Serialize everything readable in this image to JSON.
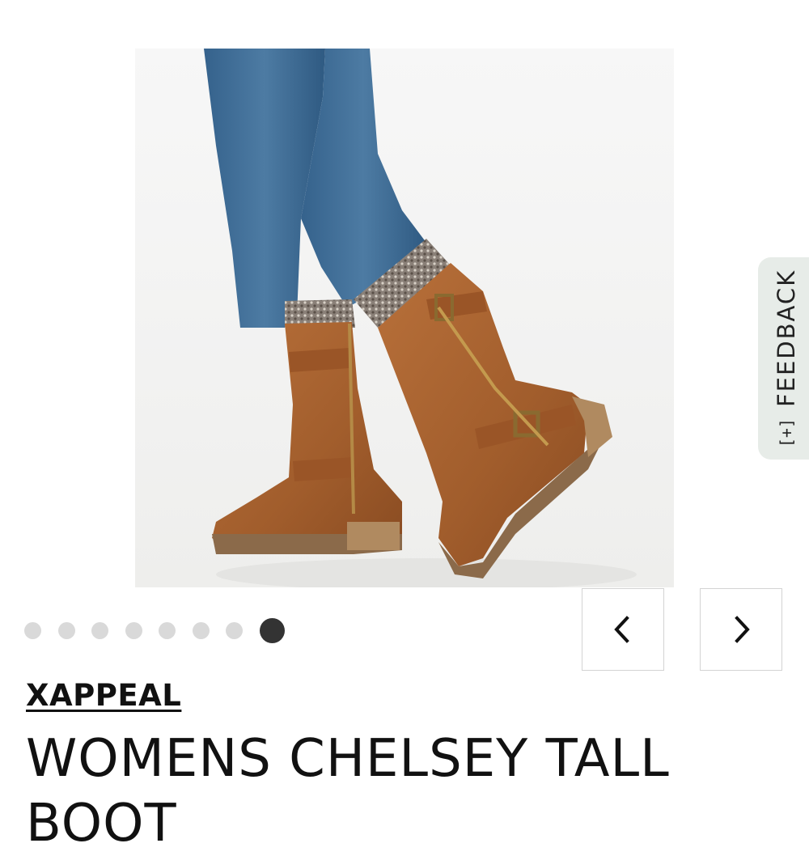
{
  "product": {
    "brand": "XAPPEAL",
    "title": "WOMENS CHELSEY TALL BOOT",
    "image_alt": "Woman wearing cognac tall boots with sweater cuffs and buckles"
  },
  "carousel": {
    "total_slides": 8,
    "active_index": 7,
    "prev_icon": "chevron-left-icon",
    "next_icon": "chevron-right-icon"
  },
  "feedback": {
    "label": "FEEDBACK",
    "icon": "[+]"
  },
  "colors": {
    "dot_inactive": "#d9d9d9",
    "dot_active": "#333333",
    "feedback_bg": "#e7ece8",
    "boot_leather": "#a8612f",
    "denim": "#3f6d96"
  }
}
